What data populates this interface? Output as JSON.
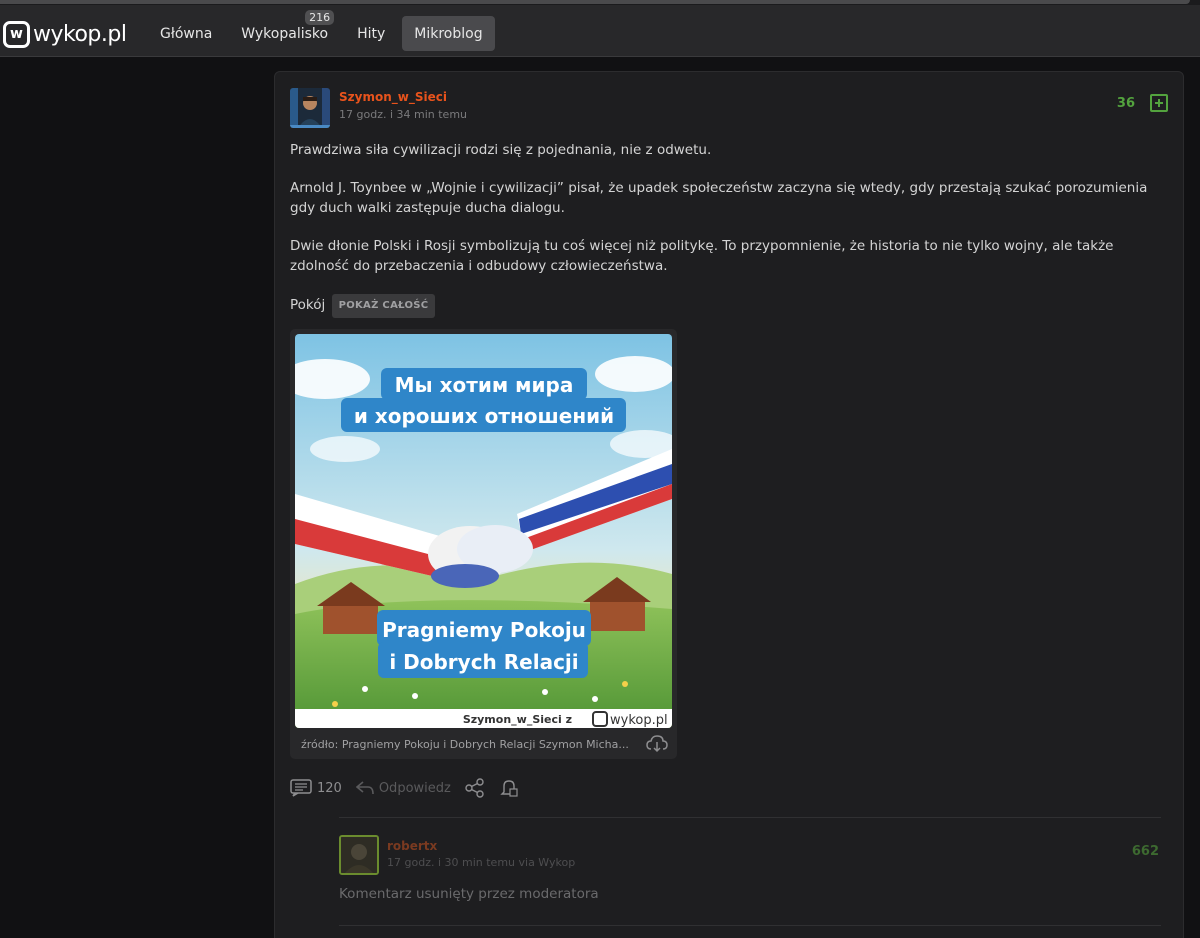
{
  "brand": {
    "logo_glyph": "w",
    "logo_text": "wykop.pl"
  },
  "nav": {
    "items": [
      {
        "label": "Główna"
      },
      {
        "label": "Wykopalisko",
        "badge": "216"
      },
      {
        "label": "Hity"
      },
      {
        "label": "Mikroblog"
      }
    ]
  },
  "post": {
    "author": "Szymon_w_Sieci",
    "time": "17 godz. i 34 min temu",
    "votes": "36",
    "paragraphs": [
      "Prawdziwa siła cywilizacji rodzi się z pojednania, nie z odwetu.",
      "Arnold J. Toynbee w „Wojnie i cywilizacji” pisał, że upadek społeczeństw zaczyna się wtedy, gdy przestają szukać porozumienia gdy duch walki zastępuje ducha dialogu.",
      "Dwie dłonie Polski i Rosji symbolizują tu coś więcej niż politykę. To przypomnienie, że historia to nie tylko wojny, ale także zdolność do przebaczenia i odbudowy człowieczeństwa."
    ],
    "last_word": "Pokój",
    "show_all_label": "POKAŻ CAŁOŚĆ",
    "image": {
      "top_text_line1": "Мы хотим мира",
      "top_text_line2": "и хороших отношений",
      "bottom_text_line1": "Pragniemy Pokoju",
      "bottom_text_line2": "i Dobrych Relacji",
      "watermark_user": "Szymon_w_Sieci  z",
      "watermark_brand": "wykop.pl",
      "source": "źródło: Pragniemy Pokoju i Dobrych Relacji Szymon Micha..."
    },
    "actions": {
      "comments_count": "120",
      "reply_label": "Odpowiedz"
    }
  },
  "comment": {
    "author": "robertx",
    "time": "17 godz. i 30 min temu  via Wykop",
    "votes": "662",
    "text": "Komentarz usunięty przez moderatora"
  },
  "colors": {
    "accent_orange": "#e8531c",
    "vote_green": "#53a33e",
    "background": "#111113",
    "card": "#1e1e20"
  }
}
